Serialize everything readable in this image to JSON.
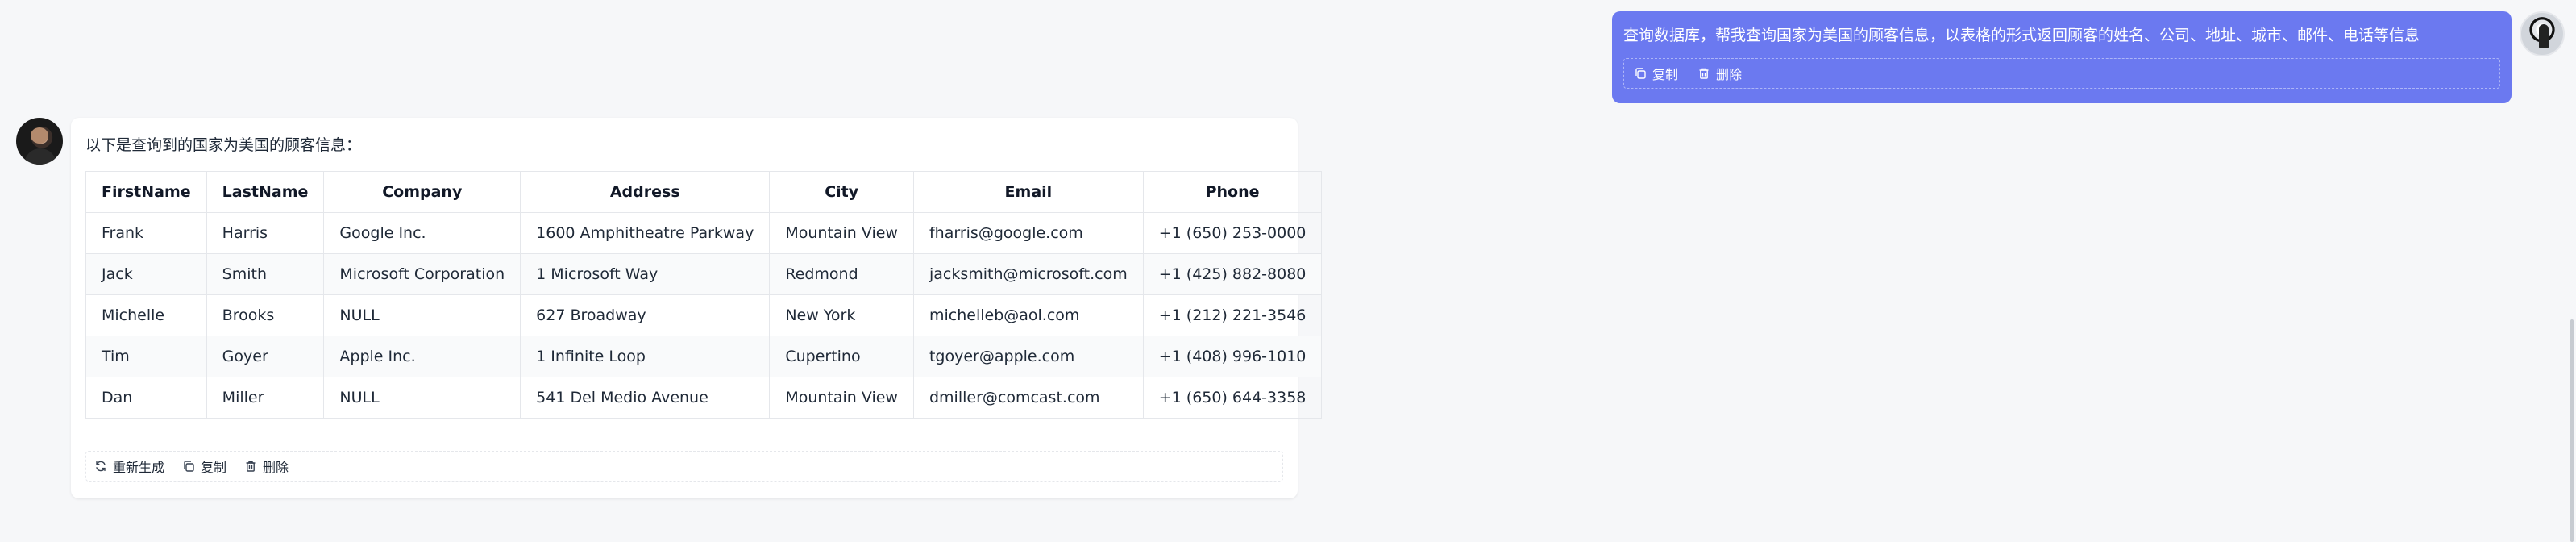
{
  "user_message": {
    "text": "查询数据库，帮我查询国家为美国的顾客信息，以表格的形式返回顾客的姓名、公司、地址、城市、邮件、电话等信息",
    "actions": {
      "copy": "复制",
      "delete": "删除"
    }
  },
  "assistant_message": {
    "intro": "以下是查询到的国家为美国的顾客信息：",
    "table": {
      "headers": [
        "FirstName",
        "LastName",
        "Company",
        "Address",
        "City",
        "Email",
        "Phone"
      ],
      "rows": [
        [
          "Frank",
          "Harris",
          "Google Inc.",
          "1600 Amphitheatre Parkway",
          "Mountain View",
          "fharris@google.com",
          "+1 (650) 253-0000"
        ],
        [
          "Jack",
          "Smith",
          "Microsoft Corporation",
          "1 Microsoft Way",
          "Redmond",
          "jacksmith@microsoft.com",
          "+1 (425) 882-8080"
        ],
        [
          "Michelle",
          "Brooks",
          "NULL",
          "627 Broadway",
          "New York",
          "michelleb@aol.com",
          "+1 (212) 221-3546"
        ],
        [
          "Tim",
          "Goyer",
          "Apple Inc.",
          "1 Infinite Loop",
          "Cupertino",
          "tgoyer@apple.com",
          "+1 (408) 996-1010"
        ],
        [
          "Dan",
          "Miller",
          "NULL",
          "541 Del Medio Avenue",
          "Mountain View",
          "dmiller@comcast.com",
          "+1 (650) 644-3358"
        ]
      ]
    },
    "actions": {
      "regenerate": "重新生成",
      "copy": "复制",
      "delete": "删除"
    }
  },
  "colors": {
    "user_bubble": "#6b79f0",
    "background": "#f6f7f9",
    "card": "#ffffff"
  },
  "icons": {
    "copy": "copy-icon",
    "delete": "trash-icon",
    "regenerate": "refresh-icon"
  }
}
